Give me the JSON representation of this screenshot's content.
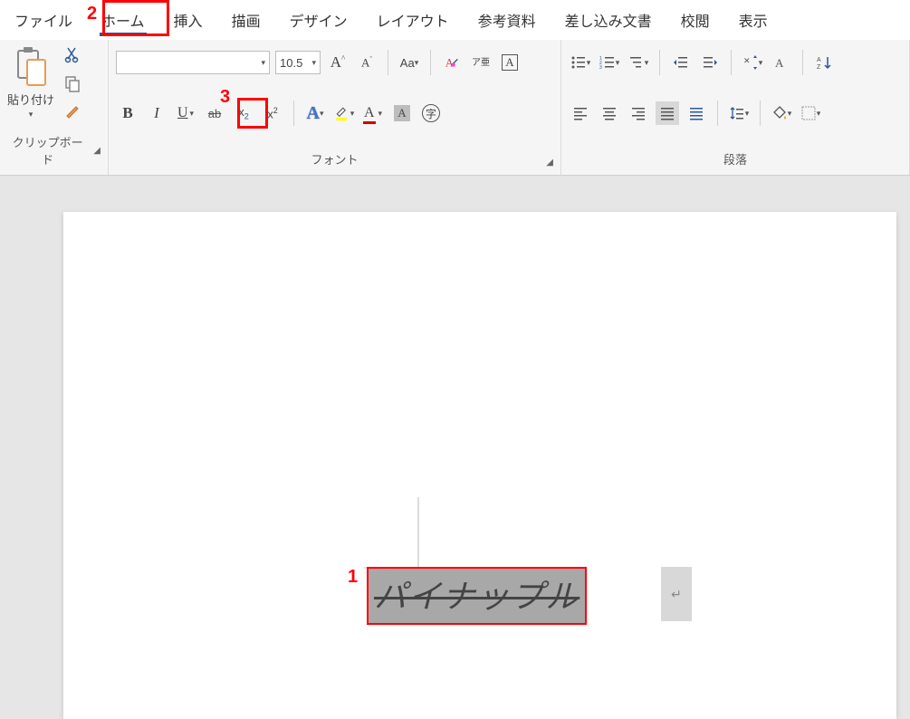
{
  "menu": {
    "file": "ファイル",
    "home": "ホーム",
    "insert": "挿入",
    "draw": "描画",
    "design": "デザイン",
    "layout": "レイアウト",
    "references": "参考資料",
    "mailings": "差し込み文書",
    "review": "校閲",
    "view": "表示"
  },
  "clipboard": {
    "paste_label": "貼り付け",
    "group_label": "クリップボード"
  },
  "font": {
    "name": "",
    "size": "10.5",
    "group_label": "フォント",
    "bold": "B",
    "italic": "I",
    "underline": "U",
    "strike": "ab",
    "subscript": "x",
    "superscript": "x",
    "text_effects": "A",
    "change_case": "Aa",
    "phonetic": "ア亜",
    "char_border": "A",
    "char_shade": "A",
    "enclose": "字"
  },
  "paragraph": {
    "group_label": "段落"
  },
  "document": {
    "selected_text": "パイナップル",
    "para_mark": "↵"
  },
  "callouts": {
    "n1": "1",
    "n2": "2",
    "n3": "3"
  }
}
